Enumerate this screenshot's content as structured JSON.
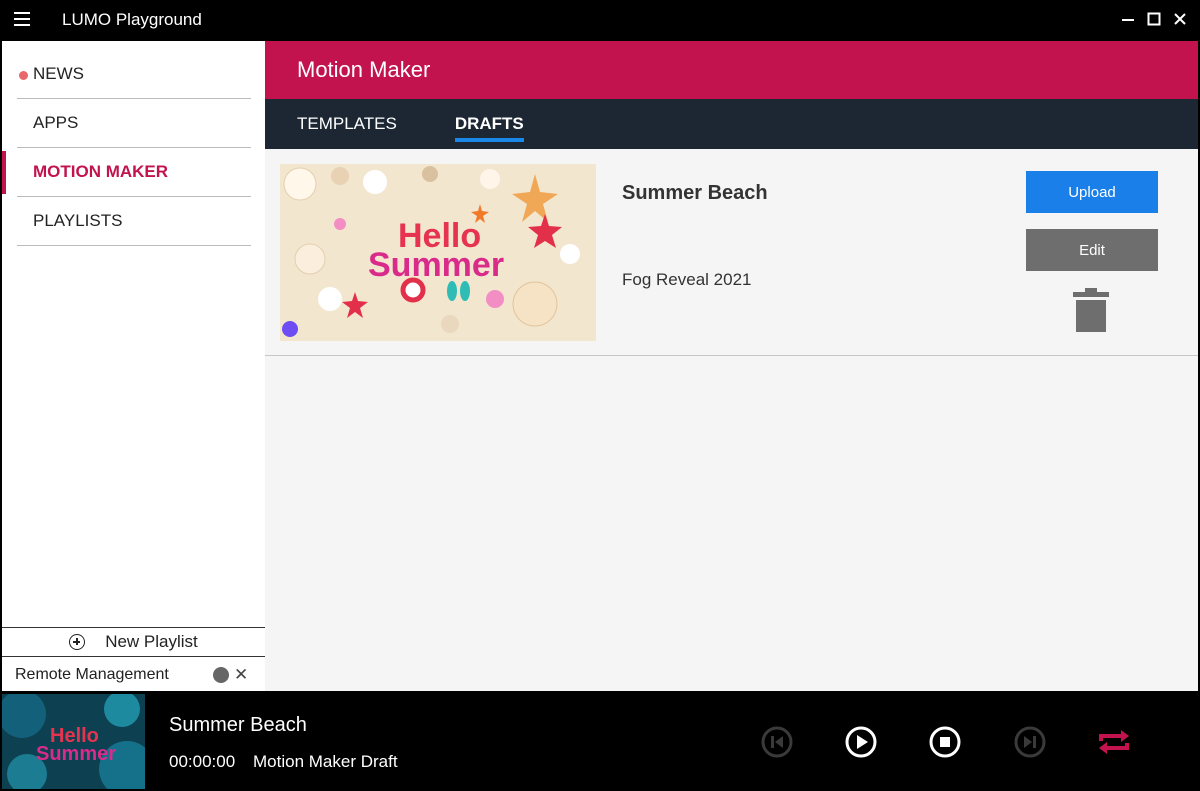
{
  "window": {
    "title": "LUMO Playground"
  },
  "sidebar": {
    "items": [
      {
        "label": "NEWS",
        "has_dot": true
      },
      {
        "label": "APPS"
      },
      {
        "label": "MOTION MAKER",
        "active": true
      },
      {
        "label": "PLAYLISTS"
      }
    ],
    "new_playlist_label": "New Playlist",
    "remote_label": "Remote Management"
  },
  "main": {
    "title": "Motion Maker",
    "tabs": [
      {
        "label": "TEMPLATES"
      },
      {
        "label": "DRAFTS",
        "active": true
      }
    ],
    "drafts": [
      {
        "title": "Summer Beach",
        "template": "Fog Reveal 2021",
        "thumbnail_text_1": "Hello",
        "thumbnail_text_2": "Summer",
        "upload_label": "Upload",
        "edit_label": "Edit"
      }
    ]
  },
  "player": {
    "title": "Summer Beach",
    "time": "00:00:00",
    "description": "Motion Maker Draft",
    "thumbnail_text_1": "Hello",
    "thumbnail_text_2": "Summer"
  },
  "colors": {
    "accent": "#c2134f",
    "tab_bar": "#1c2733",
    "upload": "#1a7fe8",
    "edit": "#6e6e6e",
    "repeat": "#c2134f"
  }
}
